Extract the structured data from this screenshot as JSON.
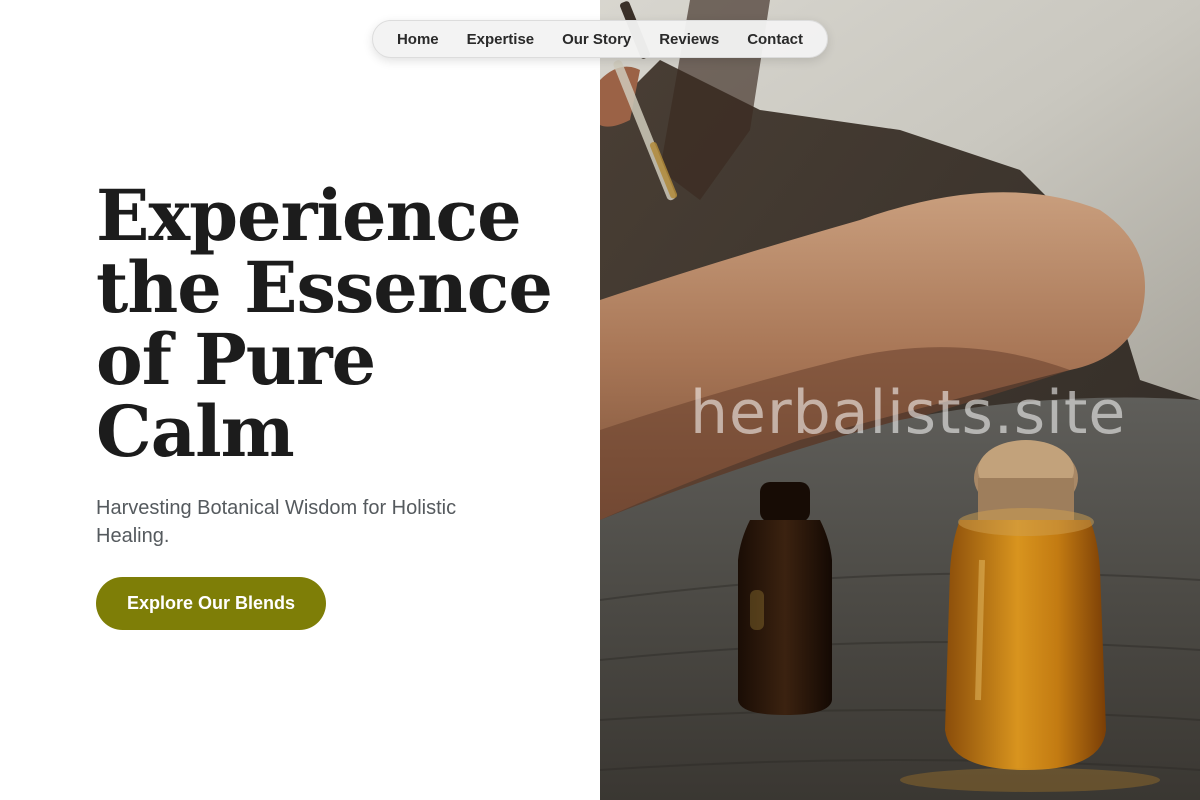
{
  "nav": {
    "items": [
      "Home",
      "Expertise",
      "Our Story",
      "Reviews",
      "Contact"
    ]
  },
  "hero": {
    "headline_lines": [
      "Experience",
      "the Essence",
      "of Pure",
      "Calm"
    ],
    "subheadline": "Harvesting Botanical Wisdom for Holistic Healing.",
    "cta_label": "Explore Our Blends"
  },
  "image": {
    "icon": "herbal-oil-photo",
    "watermark": "herbalists.site"
  },
  "colors": {
    "accent": "#7e7e07",
    "headline": "#1c1c1c",
    "subheadline": "#555a5e",
    "nav_bg": "#f3f3f3"
  }
}
